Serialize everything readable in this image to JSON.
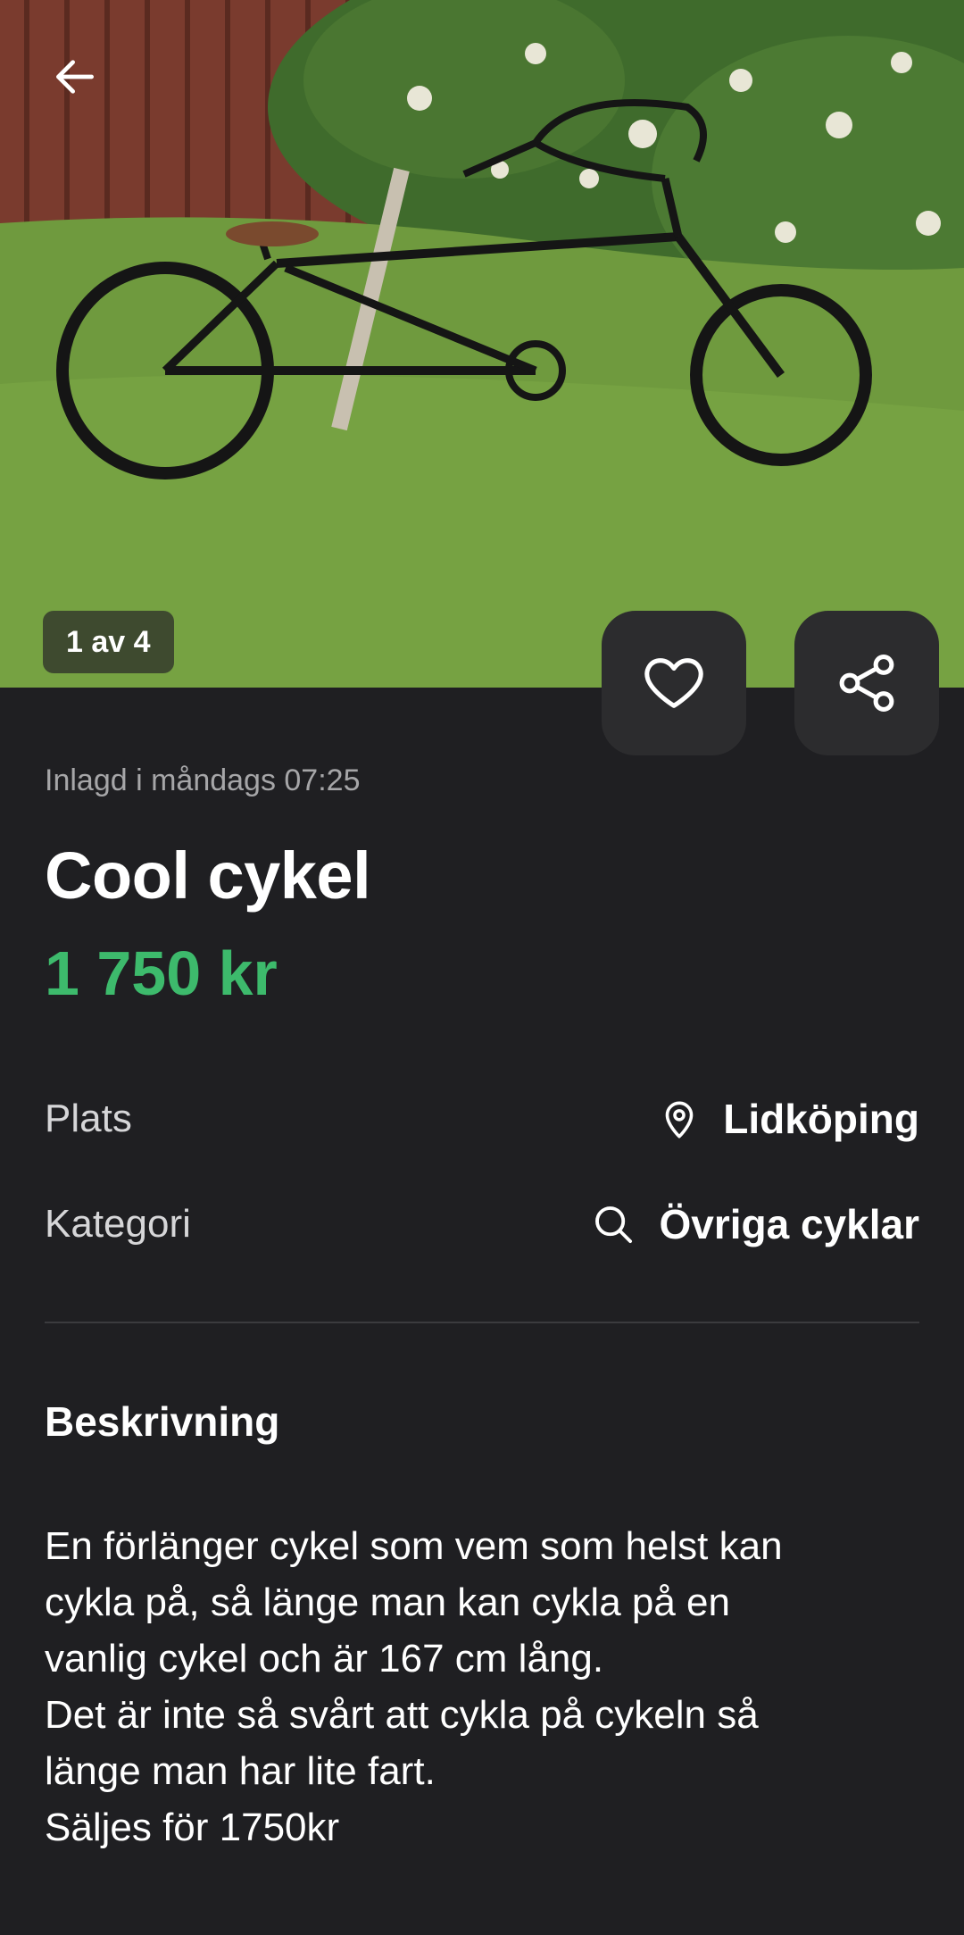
{
  "gallery": {
    "counter": "1 av 4",
    "image_alt": "bike-photo"
  },
  "listing": {
    "posted": "Inlagd i måndags 07:25",
    "title": "Cool cykel",
    "price": "1 750 kr"
  },
  "details": {
    "plats_label": "Plats",
    "plats_value": "Lidköping",
    "kategori_label": "Kategori",
    "kategori_value": "Övriga cyklar"
  },
  "description": {
    "heading": "Beskrivning",
    "text": "En förlänger cykel som vem som helst kan\ncykla på, så länge man kan cykla på en\nvanlig cykel och är 167 cm lång.\nDet är inte så svårt att cykla på cykeln så\nlänge man har lite fart.\nSäljes för 1750kr"
  },
  "icons": {
    "back": "arrow-left-icon",
    "favorite": "heart-icon",
    "share": "share-icon",
    "location": "map-pin-icon",
    "category": "search-icon"
  },
  "colors": {
    "background": "#1f1f22",
    "price": "#3dba6c",
    "muted": "#a6a6a8",
    "button": "#2c2c2e"
  }
}
